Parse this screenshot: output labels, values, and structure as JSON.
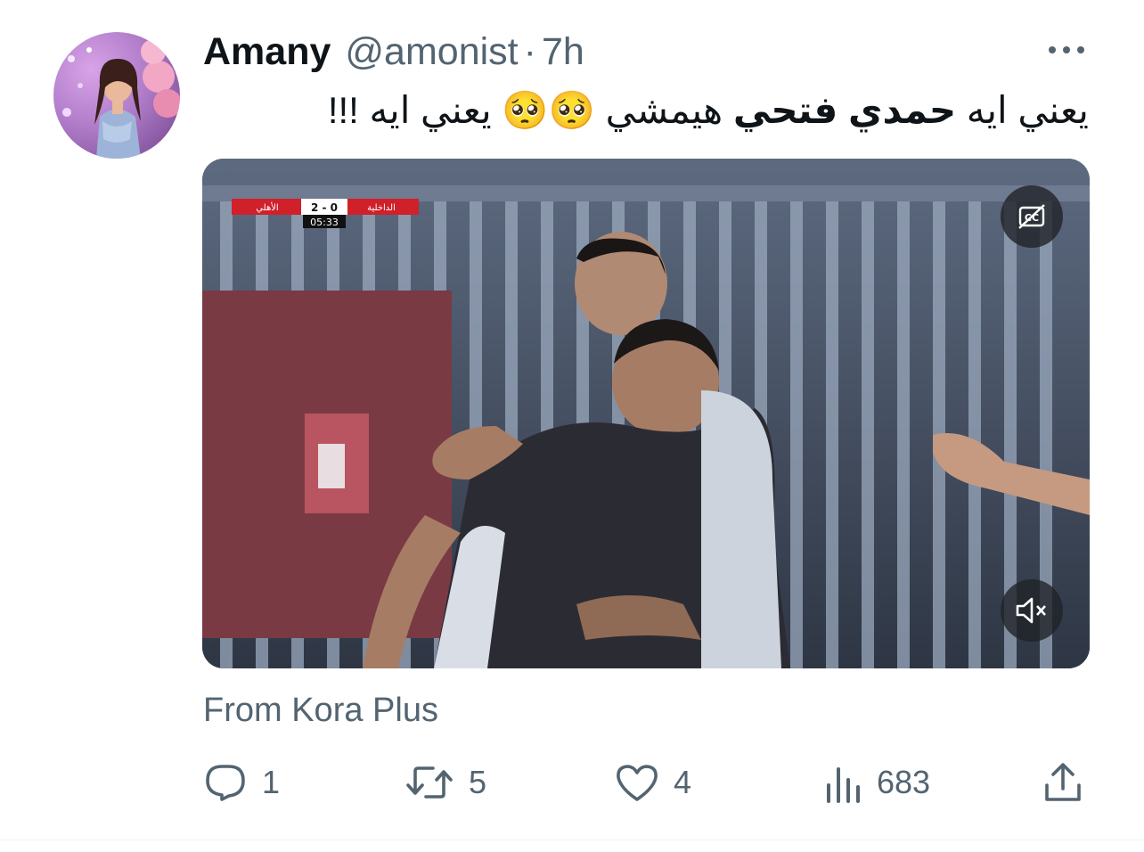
{
  "tweet": {
    "author_name": "Amany",
    "handle": "@amonist",
    "separator": "·",
    "time": "7h",
    "text_part1": "يعني ايه ",
    "text_bold": "حمدي فتحي",
    "text_part2": " هيمشي ",
    "emoji": "🥺🥺",
    "text_part3": " يعني ايه  !!!",
    "source": "From Kora Plus"
  },
  "video": {
    "score_team_right": "الداخلية",
    "score_team_left": "الأهلي",
    "score": "2 - 0",
    "clock": "05:33",
    "cc_icon": "closed-captions-off-icon",
    "mute_icon": "muted-speaker-icon"
  },
  "actions": {
    "replies": "1",
    "retweets": "5",
    "likes": "4",
    "views": "683"
  },
  "colors": {
    "text": "#0f1419",
    "secondary": "#536471",
    "score_red": "#d0202a"
  }
}
